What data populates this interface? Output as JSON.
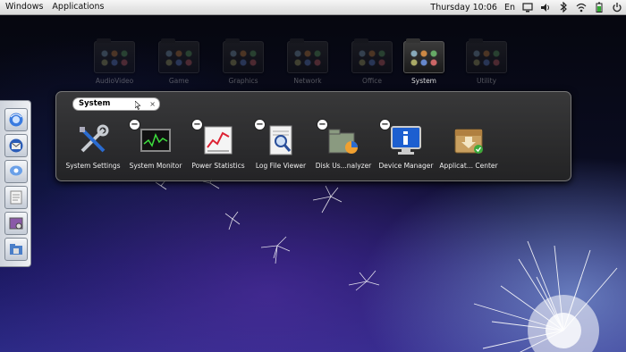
{
  "top_panel": {
    "menus": [
      "Windows",
      "Applications"
    ],
    "clock": "Thursday 10:06",
    "keyboard_layout": "En"
  },
  "categories": [
    {
      "label": "AudioVideo",
      "active": false
    },
    {
      "label": "Game",
      "active": false
    },
    {
      "label": "Graphics",
      "active": false
    },
    {
      "label": "Network",
      "active": false
    },
    {
      "label": "Office",
      "active": false
    },
    {
      "label": "System",
      "active": true
    },
    {
      "label": "Utility",
      "active": false
    }
  ],
  "search": {
    "value": "System",
    "clear_glyph": "×"
  },
  "apps": [
    {
      "label": "System Settings",
      "icon": "tools-icon",
      "removable": false
    },
    {
      "label": "System Monitor",
      "icon": "system-monitor-icon",
      "removable": true
    },
    {
      "label": "Power Statistics",
      "icon": "power-statistics-icon",
      "removable": true
    },
    {
      "label": "Log File Viewer",
      "icon": "log-viewer-icon",
      "removable": true
    },
    {
      "label": "Disk Us...nalyzer",
      "icon": "disk-usage-icon",
      "removable": true
    },
    {
      "label": "Device Manager",
      "icon": "device-manager-icon",
      "removable": true
    },
    {
      "label": "Applicat... Center",
      "icon": "app-center-icon",
      "removable": false
    }
  ],
  "dock": [
    {
      "icon": "browser-icon"
    },
    {
      "icon": "mail-icon"
    },
    {
      "icon": "chat-icon"
    },
    {
      "icon": "document-icon"
    },
    {
      "icon": "settings-panel-icon"
    },
    {
      "icon": "file-manager-icon"
    }
  ],
  "colors": {
    "panel_bg": "#e4e4e4",
    "launcher_bg": "#2e2e2e",
    "accent_blue": "#3a6fd8"
  }
}
